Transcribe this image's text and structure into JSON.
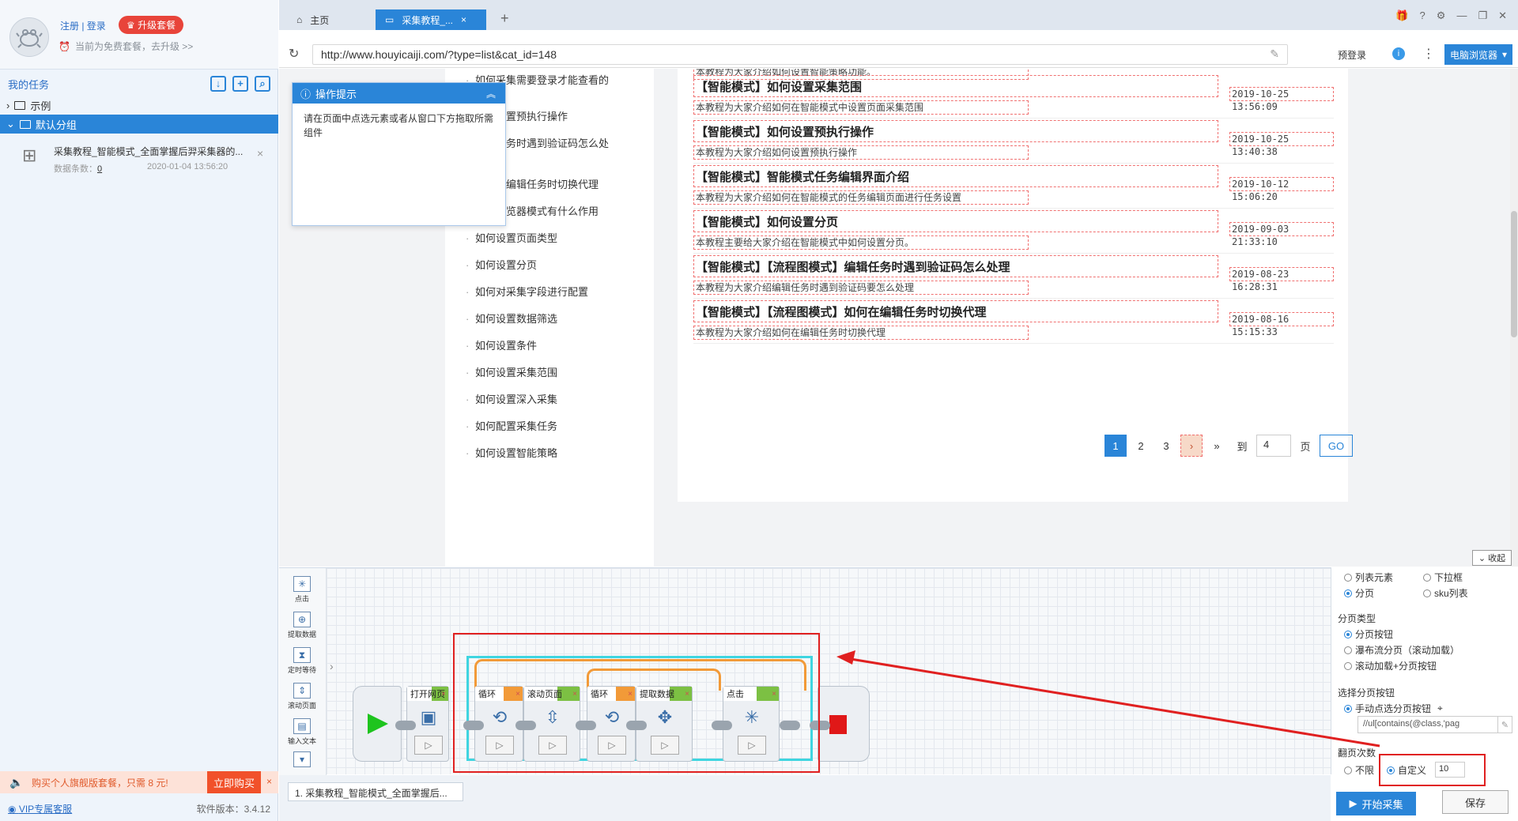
{
  "sidebar": {
    "login_link": "注册 | 登录",
    "upgrade_button": "升级套餐",
    "plan_note": "当前为免费套餐，去升级 >>",
    "my_tasks_label": "我的任务",
    "tree": [
      {
        "label": "示例"
      },
      {
        "label": "默认分组"
      }
    ],
    "task": {
      "name": "采集教程_智能模式_全面掌握后羿采集器的...",
      "count_label": "数据条数：",
      "count_value": "0",
      "date": "2020-01-04 13:56:20"
    },
    "promo": {
      "text": "购买个人旗舰版套餐，只需 8 元!",
      "buy_label": "立即购买"
    },
    "footer": {
      "vip_link": "VIP专属客服",
      "version": "软件版本：3.4.12"
    }
  },
  "browser": {
    "tabs": [
      {
        "label": "主页"
      },
      {
        "label": "采集教程_..."
      }
    ],
    "tab_add": "+",
    "url": "http://www.houyicaiji.com/?type=list&cat_id=148",
    "prelogin": "预登录",
    "browser_mode": "电脑浏览器"
  },
  "tip": {
    "title": "操作提示",
    "body": "请在页面中点选元素或者从窗口下方拖取所需组件"
  },
  "nav_links": [
    "如何采集需要登录才能查看的网页",
    "如何设置预执行操作",
    "编辑任务时遇到验证码怎么处理",
    "如何在编辑任务时切换代理",
    "切换浏览器模式有什么作用",
    "如何设置页面类型",
    "如何设置分页",
    "如何对采集字段进行配置",
    "如何设置数据筛选",
    "如何设置条件",
    "如何设置采集范围",
    "如何设置深入采集",
    "如何配置采集任务",
    "如何设置智能策略"
  ],
  "articles": {
    "top_fragment": "本教程为大家介绍如何设置智能策略功能。",
    "items": [
      {
        "title": "【智能模式】如何设置采集范围",
        "desc": "本教程为大家介绍如何在智能模式中设置页面采集范围",
        "date": "2019-10-25 13:56:09"
      },
      {
        "title": "【智能模式】如何设置预执行操作",
        "desc": "本教程为大家介绍如何设置预执行操作",
        "date": "2019-10-25 13:40:38"
      },
      {
        "title": "【智能模式】智能模式任务编辑界面介绍",
        "desc": "本教程为大家介绍如何在智能模式的任务编辑页面进行任务设置",
        "date": "2019-10-12 15:06:20"
      },
      {
        "title": "【智能模式】如何设置分页",
        "desc": "本教程主要给大家介绍在智能模式中如何设置分页。",
        "date": "2019-09-03 21:33:10"
      },
      {
        "title": "【智能模式】【流程图模式】编辑任务时遇到验证码怎么处理",
        "desc": "本教程为大家介绍编辑任务时遇到验证码要怎么处理",
        "date": "2019-08-23 16:28:31"
      },
      {
        "title": "【智能模式】【流程图模式】如何在编辑任务时切换代理",
        "desc": "本教程为大家介绍如何在编辑任务时切换代理",
        "date": "2019-08-16 15:15:33"
      }
    ]
  },
  "pager": {
    "pages": [
      "1",
      "2",
      "3"
    ],
    "next": "›",
    "last": "»",
    "goto_label": "到",
    "goto_value": "4",
    "page_unit": "页",
    "go": "GO"
  },
  "collapse_label": "收起",
  "tools": [
    {
      "label": "点击"
    },
    {
      "label": "提取数据"
    },
    {
      "label": "定时等待"
    },
    {
      "label": "滚动页面"
    },
    {
      "label": "输入文本"
    }
  ],
  "workflow": {
    "nodes": [
      {
        "label": "打开网页",
        "icon": "web-icon"
      },
      {
        "label": "循环",
        "icon": "loop-icon"
      },
      {
        "label": "滚动页面",
        "icon": "scroll-icon"
      },
      {
        "label": "循环",
        "icon": "loop-icon"
      },
      {
        "label": "提取数据",
        "icon": "extract-icon"
      },
      {
        "label": "点击",
        "icon": "click-icon"
      }
    ],
    "bottom_tab": "1. 采集教程_智能模式_全面掌握后..."
  },
  "settings": {
    "page_type_options": [
      "列表元素",
      "下拉框",
      "分页",
      "sku列表"
    ],
    "pagination_type_label": "分页类型",
    "pagination_types": [
      "分页按钮",
      "瀑布流分页（滚动加载）",
      "滚动加载+分页按钮"
    ],
    "select_button_label": "选择分页按钮",
    "select_button_option": "手动点选分页按钮",
    "xpath": "//ul[contains(@class,'pag",
    "page_count_label": "翻页次数",
    "page_count_options": [
      "不限",
      "自定义"
    ],
    "custom_value": "10"
  },
  "actions": {
    "start": "开始采集",
    "save": "保存"
  },
  "colors": {
    "accent": "#2a85d8",
    "annotation": "#e02020",
    "loop_highlight": "#3fd5e0",
    "loop_orange": "#f29a38",
    "node_green": "#7cc043"
  }
}
